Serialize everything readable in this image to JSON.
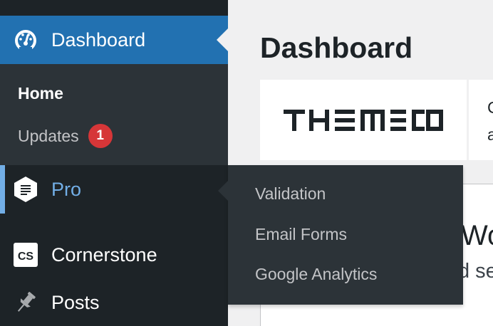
{
  "sidebar": {
    "dashboard_label": "Dashboard",
    "submenu": {
      "home_label": "Home",
      "updates_label": "Updates",
      "updates_count": "1"
    },
    "pro_label": "Pro",
    "cornerstone_label": "Cornerstone",
    "cornerstone_icon_text": "CS",
    "posts_label": "Posts"
  },
  "flyout": {
    "items": [
      "Validation",
      "Email Forms",
      "Google Analytics"
    ]
  },
  "main": {
    "title": "Dashboard",
    "brand_logo_text": "THEMECO",
    "card_partial_lines": [
      "C",
      "a"
    ],
    "panel_partial_title": "Wo",
    "panel_partial_sub": "d se"
  },
  "colors": {
    "sidebar_bg": "#1d2327",
    "submenu_bg": "#2c3338",
    "active_blue": "#2271b1",
    "pro_accent": "#72aee6",
    "badge_red": "#d63638",
    "content_bg": "#f0f0f1"
  }
}
